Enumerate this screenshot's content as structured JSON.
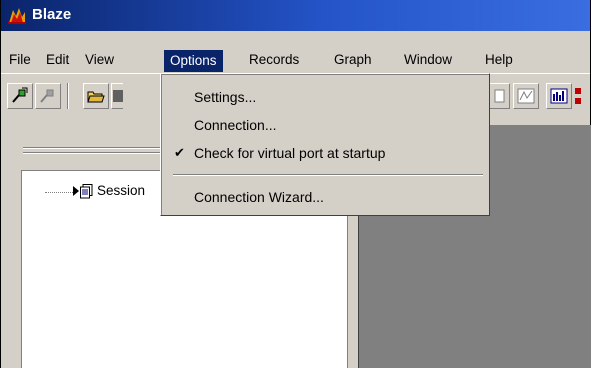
{
  "window": {
    "title": "Blaze",
    "app_icon": "blaze-logo-icon"
  },
  "menubar": {
    "items": [
      {
        "label": "File"
      },
      {
        "label": "Edit"
      },
      {
        "label": "View"
      },
      {
        "label": "Options"
      },
      {
        "label": "Records"
      },
      {
        "label": "Graph"
      },
      {
        "label": "Window"
      },
      {
        "label": "Help"
      }
    ]
  },
  "options_menu": {
    "items": [
      {
        "label": "Settings...",
        "checked": false
      },
      {
        "label": "Connection...",
        "checked": false
      },
      {
        "label": "Check for virtual port at startup",
        "checked": true
      },
      {
        "label": "Connection Wizard...",
        "checked": false
      }
    ],
    "check_glyph": "✔"
  },
  "toolbar": {
    "buttons": [
      "connect-icon",
      "disconnect-icon",
      "open-folder-icon",
      "save-icon",
      "report-icon",
      "chart-line-icon",
      "bar-chart-icon"
    ]
  },
  "tree": {
    "items": [
      {
        "label": "Session"
      }
    ]
  },
  "colors": {
    "titlebar_start": "#0a246a",
    "titlebar_end": "#3a6ee0",
    "menu_highlight": "#0a246a",
    "face": "#d4d0c8",
    "workspace": "#808080"
  }
}
